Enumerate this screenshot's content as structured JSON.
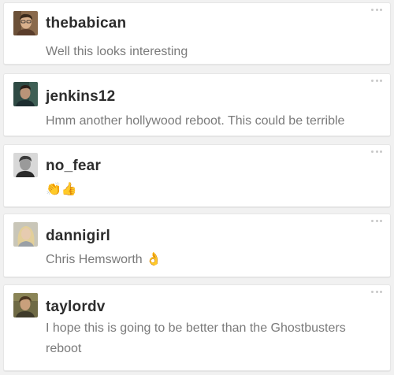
{
  "comments": [
    {
      "username": "thebabican",
      "message": "Well this looks interesting",
      "avatar_icon": "user-avatar-icon",
      "avatar_colors": {
        "bg": "#8a6a4c",
        "skin": "#d9b08c",
        "hair": "#3a2a1c",
        "shirt": "#5a3d2b"
      }
    },
    {
      "username": "jenkins12",
      "message": "Hmm another hollywood reboot. This could be terrible",
      "avatar_icon": "user-avatar-icon",
      "avatar_colors": {
        "bg": "#2f4a44",
        "skin": "#b99478",
        "hair": "#2a1f18",
        "shirt": "#1d2d30"
      }
    },
    {
      "username": "no_fear",
      "message": "👏👍",
      "avatar_icon": "user-avatar-icon",
      "avatar_colors": {
        "bg": "#d8d8d8",
        "skin": "#9a9a9a",
        "hair": "#3b3b3b",
        "shirt": "#2a2a2a"
      }
    },
    {
      "username": "dannigirl",
      "message": "Chris Hemsworth 👌",
      "avatar_icon": "user-avatar-icon",
      "avatar_colors": {
        "bg": "#c9c6b8",
        "skin": "#e6cbb0",
        "hair": "#e2cf9a",
        "shirt": "#9aa0a6"
      }
    },
    {
      "username": "taylordv",
      "message": "I hope this is going to be better than the Ghostbusters reboot",
      "avatar_icon": "user-avatar-icon",
      "avatar_colors": {
        "bg": "#6f6a45",
        "skin": "#c9a07c",
        "hair": "#4a3520",
        "shirt": "#3e3a2a"
      }
    }
  ],
  "more_icon": "more-options-icon"
}
